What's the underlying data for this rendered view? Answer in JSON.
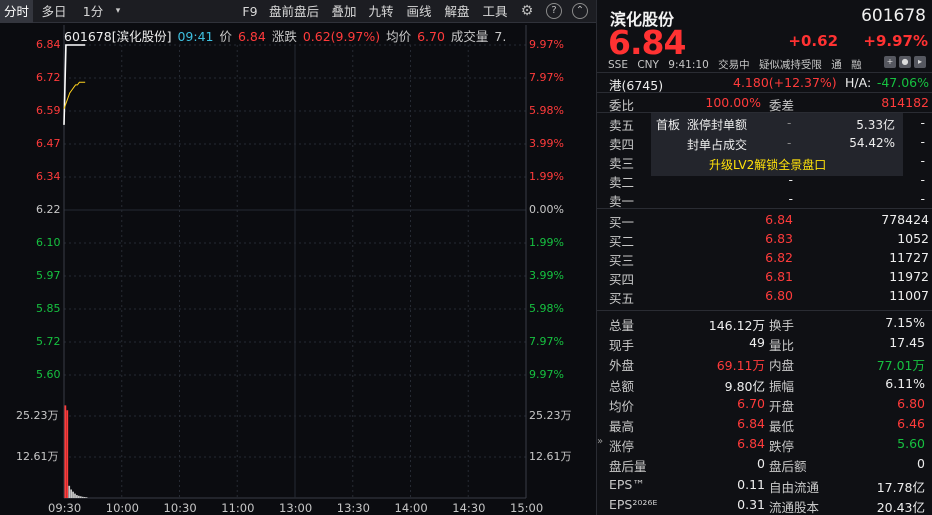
{
  "toolbar": {
    "items": [
      "分时",
      "多日",
      "1分",
      "F9",
      "盘前盘后",
      "叠加",
      "九转",
      "画线",
      "解盘",
      "工具"
    ]
  },
  "chart_info": {
    "code_name": "601678[滨化股份]",
    "time": "09:41",
    "price_label": "价",
    "price": "6.84",
    "change_label": "涨跌",
    "change": "0.62(9.97%)",
    "avg_label": "均价",
    "avg": "6.70",
    "vol_label": "成交量",
    "vol": "7."
  },
  "colors": {
    "up": "#ff3b3b",
    "down": "#16c140",
    "flat": "#c8c8c8",
    "price_line": "#ffffff",
    "avg_line": "#ffd21e",
    "grid": "#262a33"
  },
  "chart_data": {
    "type": "line",
    "prev_close": 6.22,
    "price_axis": [
      "6.84",
      "6.72",
      "6.59",
      "6.47",
      "6.34",
      "6.22",
      "6.10",
      "5.97",
      "5.85",
      "5.72",
      "5.60"
    ],
    "pct_axis": [
      "9.97%",
      "7.97%",
      "5.98%",
      "3.99%",
      "1.99%",
      "0.00%",
      "1.99%",
      "3.99%",
      "5.98%",
      "7.97%",
      "9.97%"
    ],
    "vol_axis": [
      "25.23万",
      "12.61万"
    ],
    "x_ticks": [
      "09:30",
      "10:00",
      "10:30",
      "11:00",
      "13:00",
      "13:30",
      "14:00",
      "14:30",
      "15:00"
    ],
    "ylim": [
      5.6,
      6.84
    ],
    "price_series": {
      "x": [
        "09:30",
        "09:31",
        "09:32",
        "09:33",
        "09:34",
        "09:35",
        "09:36",
        "09:37",
        "09:38",
        "09:39",
        "09:40",
        "09:41"
      ],
      "values": [
        6.54,
        6.84,
        6.84,
        6.84,
        6.84,
        6.84,
        6.84,
        6.84,
        6.84,
        6.84,
        6.84,
        6.84
      ]
    },
    "avg_series": {
      "x": [
        "09:30",
        "09:31",
        "09:32",
        "09:33",
        "09:34",
        "09:35",
        "09:36",
        "09:37",
        "09:38",
        "09:39",
        "09:40",
        "09:41"
      ],
      "values": [
        6.6,
        6.62,
        6.64,
        6.66,
        6.67,
        6.68,
        6.69,
        6.69,
        6.7,
        6.7,
        6.7,
        6.7
      ]
    },
    "volume_series": {
      "x": [
        "09:30",
        "09:31",
        "09:32",
        "09:33",
        "09:34",
        "09:35",
        "09:36",
        "09:37",
        "09:38",
        "09:39",
        "09:40",
        "09:41"
      ],
      "values": [
        38.0,
        36.0,
        5.0,
        3.5,
        2.6,
        1.8,
        1.2,
        0.9,
        0.7,
        0.5,
        0.4,
        0.3
      ],
      "unit": "万"
    }
  },
  "quote": {
    "name": "滨化股份",
    "code": "601678",
    "price": "6.84",
    "change": "+0.62",
    "change_pct": "+9.97%",
    "exchange": "SSE",
    "currency": "CNY",
    "time": "9:41:10",
    "status": "交易中",
    "tag": "疑似减持受限",
    "tag2": "通",
    "tag3": "融",
    "hk_label": "港(6745)",
    "hk_price": "4.180(+12.37%)",
    "ha_label": "H/A:",
    "ha_value": "-47.06%",
    "weibi_label": "委比",
    "weibi": "100.00%",
    "weicha_label": "委差",
    "weicha": "814182"
  },
  "asks": [
    {
      "label": "卖五",
      "price": "",
      "vol": "-"
    },
    {
      "label": "卖四",
      "price": "",
      "vol": "-"
    },
    {
      "label": "卖三",
      "price": "",
      "vol": "-"
    },
    {
      "label": "卖二",
      "price": "-",
      "vol": "-"
    },
    {
      "label": "卖一",
      "price": "-",
      "vol": "-"
    }
  ],
  "l2": {
    "first_board": "首板",
    "seal_label": "涨停封单额",
    "seal_dash": "-",
    "seal_value": "5.33亿",
    "ratio_label": "封单占成交",
    "ratio_dash": "-",
    "ratio_value": "54.42%",
    "upgrade": "升级LV2解锁全景盘口"
  },
  "bids": [
    {
      "label": "买一",
      "price": "6.84",
      "vol": "778424"
    },
    {
      "label": "买二",
      "price": "6.83",
      "vol": "1052"
    },
    {
      "label": "买三",
      "price": "6.82",
      "vol": "11727"
    },
    {
      "label": "买四",
      "price": "6.81",
      "vol": "11972"
    },
    {
      "label": "买五",
      "price": "6.80",
      "vol": "11007"
    }
  ],
  "stats": [
    {
      "l1": "总量",
      "v1": "146.12万",
      "c1": "white",
      "l2": "换手",
      "v2": "7.15%",
      "c2": "white"
    },
    {
      "l1": "现手",
      "v1": "49",
      "c1": "white",
      "l2": "量比",
      "v2": "17.45",
      "c2": "white"
    },
    {
      "l1": "外盘",
      "v1": "69.11万",
      "c1": "red",
      "l2": "内盘",
      "v2": "77.01万",
      "c2": "green"
    },
    {
      "l1": "总额",
      "v1": "9.80亿",
      "c1": "white",
      "l2": "振幅",
      "v2": "6.11%",
      "c2": "white"
    },
    {
      "l1": "均价",
      "v1": "6.70",
      "c1": "red",
      "l2": "开盘",
      "v2": "6.80",
      "c2": "red"
    },
    {
      "l1": "最高",
      "v1": "6.84",
      "c1": "red",
      "l2": "最低",
      "v2": "6.46",
      "c2": "red"
    },
    {
      "l1": "涨停",
      "v1": "6.84",
      "c1": "red",
      "l2": "跌停",
      "v2": "5.60",
      "c2": "green"
    },
    {
      "l1": "盘后量",
      "v1": "0",
      "c1": "white",
      "l2": "盘后额",
      "v2": "0",
      "c2": "white"
    },
    {
      "l1": "EPS™",
      "v1": "0.11",
      "c1": "white",
      "l2": "自由流通",
      "v2": "17.78亿",
      "c2": "white"
    },
    {
      "l1": "EPS²⁰²⁶ᴱ",
      "v1": "0.31",
      "c1": "white",
      "l2": "流通股本",
      "v2": "20.43亿",
      "c2": "white"
    }
  ]
}
